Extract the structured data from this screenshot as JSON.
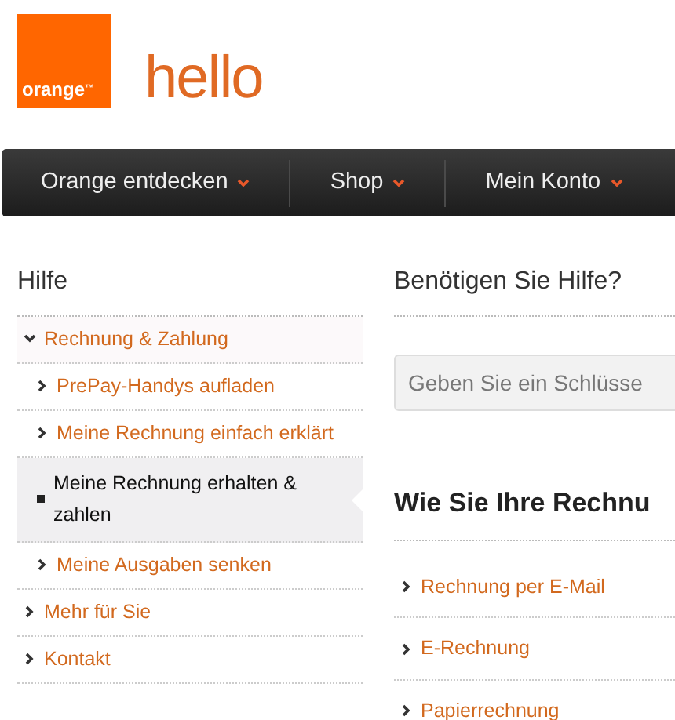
{
  "logo": {
    "text": "orange$^{™}$"
  },
  "brand_title": "hello",
  "nav": [
    {
      "label": "Orange entdecken"
    },
    {
      "label": "Shop"
    },
    {
      "label": "Mein Konto"
    }
  ],
  "sidebar": {
    "title": "Hilfe",
    "items": [
      {
        "label": "Rechnung & Zahlung",
        "expanded": true,
        "selected": false,
        "children": [
          {
            "label": "PrePay-Handys aufladen",
            "selected": false
          },
          {
            "label": "Meine Rechnung einfach erklärt",
            "selected": false
          },
          {
            "label": "Meine Rechnung erhalten & zahlen",
            "selected": true
          },
          {
            "label": "Meine Ausgaben senken",
            "selected": false
          }
        ]
      },
      {
        "label": "Mehr für Sie",
        "expanded": false,
        "selected": false
      },
      {
        "label": "Kontakt",
        "expanded": false,
        "selected": false
      }
    ]
  },
  "help": {
    "title": "Benötigen Sie Hilfe?",
    "search": {
      "placeholder": "Geben Sie ein Schlüsse"
    }
  },
  "section": {
    "title": "Wie Sie Ihre Rechnu",
    "links": [
      {
        "label": "Rechnung per E-Mail"
      },
      {
        "label": "E-Rechnung"
      },
      {
        "label": "Papierrechnung"
      }
    ]
  }
}
